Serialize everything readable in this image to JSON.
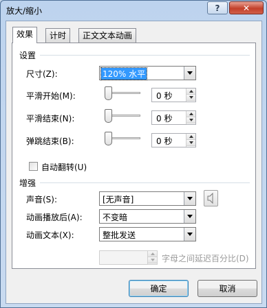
{
  "window": {
    "title": "放大/缩小",
    "help_label": "?",
    "close_label": "✕"
  },
  "tabs": [
    {
      "label": "效果",
      "active": true
    },
    {
      "label": "计时",
      "active": false
    },
    {
      "label": "正文文本动画",
      "active": false
    }
  ],
  "settings": {
    "group_label": "设置",
    "size": {
      "label": "尺寸(Z):",
      "value": "120% 水平"
    },
    "smooth_start": {
      "label": "平滑开始(M):",
      "value": "0 秒"
    },
    "smooth_end": {
      "label": "平滑结束(N):",
      "value": "0 秒"
    },
    "bounce_end": {
      "label": "弹跳结束(B):",
      "value": "0 秒"
    },
    "auto_reverse": {
      "label": "自动翻转(U)",
      "checked": false
    }
  },
  "enhance": {
    "group_label": "增强",
    "sound": {
      "label": "声音(S):",
      "value": "[无声音]"
    },
    "after_animation": {
      "label": "动画播放后(A):",
      "value": "不变暗"
    },
    "animate_text": {
      "label": "动画文本(X):",
      "value": "整批发送"
    },
    "letter_delay": {
      "label": "字母之间延迟百分比(D)",
      "value": ""
    }
  },
  "buttons": {
    "ok": "确定",
    "cancel": "取消"
  },
  "icons": {
    "sound": "speaker-icon"
  }
}
